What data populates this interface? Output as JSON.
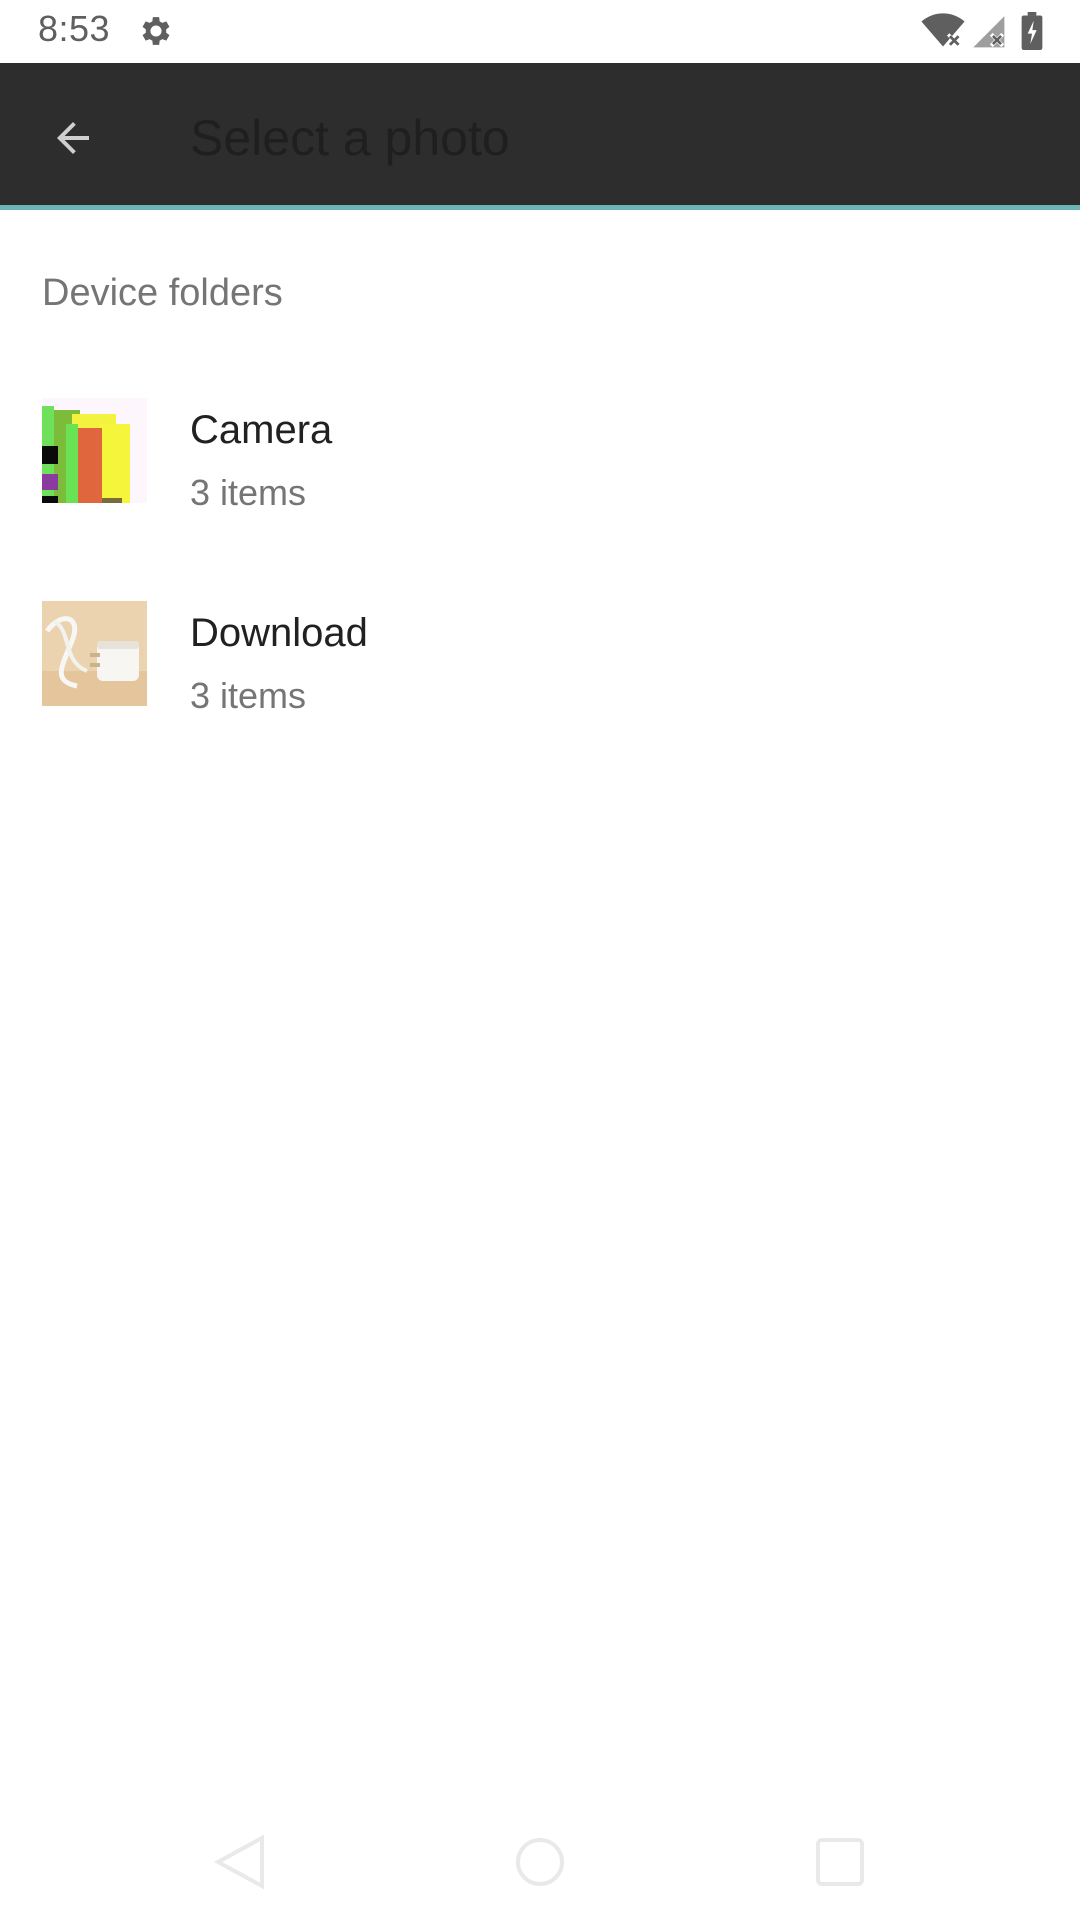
{
  "status_bar": {
    "time": "8:53",
    "icons": [
      "gear-icon",
      "wifi-off-icon",
      "signal-off-icon",
      "battery-charging-icon"
    ]
  },
  "app_bar": {
    "title": "Select a photo",
    "back_icon": "arrow-back-icon",
    "accent_color": "#6bb5b4",
    "background_color": "#2d2d2d"
  },
  "content": {
    "section_header": "Device folders",
    "folders": [
      {
        "name": "Camera",
        "count": "3 items"
      },
      {
        "name": "Download",
        "count": "3 items"
      }
    ]
  },
  "nav_bar": {
    "icons": [
      "nav-back-icon",
      "nav-home-icon",
      "nav-recents-icon"
    ]
  }
}
